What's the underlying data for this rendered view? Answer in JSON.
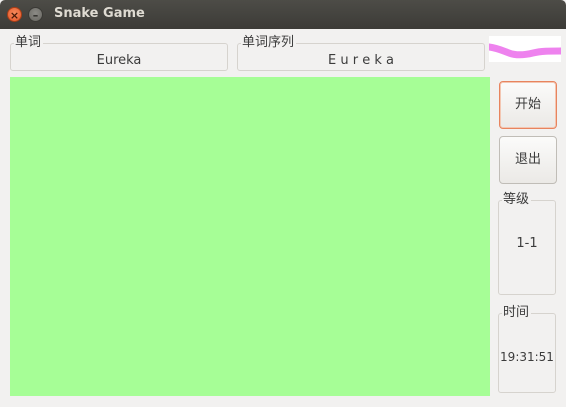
{
  "window": {
    "title": "Snake Game",
    "close_glyph": "×",
    "minimize_glyph": "–"
  },
  "word_box": {
    "label": "单词",
    "value": "Eureka"
  },
  "sequence_box": {
    "label": "单词序列",
    "value": "E u r e k a"
  },
  "buttons": {
    "start_label": "开始",
    "quit_label": "退出"
  },
  "level_box": {
    "label": "等级",
    "value": "1-1"
  },
  "time_box": {
    "label": "时间",
    "value": "19:31:51"
  },
  "colors": {
    "game_area": "#a6fe96",
    "snake_preview": "#ee82ee",
    "focus_border": "#e8845e"
  }
}
